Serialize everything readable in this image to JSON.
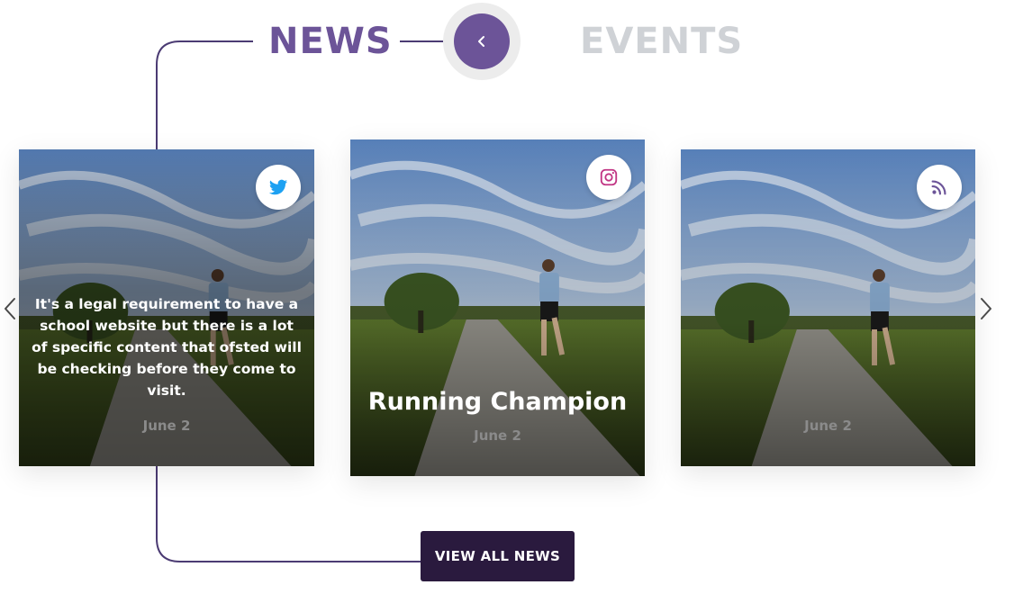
{
  "tabs": {
    "news_label": "NEWS",
    "events_label": "EVENTS",
    "active": "news"
  },
  "colors": {
    "accent": "#6c5498",
    "inactive_tab": "#cfd2d6",
    "button_bg": "#2a1a3e",
    "date_text": "#8b8b8b",
    "twitter": "#1da1f2",
    "instagram": "#c13584",
    "rss": "#6c5498"
  },
  "toggle": {
    "icon": "chevron-left-icon"
  },
  "carousel": {
    "prev_icon": "chevron-left-icon",
    "next_icon": "chevron-right-icon",
    "cards": [
      {
        "social_icon": "twitter-icon",
        "excerpt": "It's a legal requirement to have a school website but there is a lot of specific content that ofsted will be checking before they come to visit.",
        "date": "June 2"
      },
      {
        "social_icon": "instagram-icon",
        "title": "Running Champion",
        "date": "June 2"
      },
      {
        "social_icon": "rss-icon",
        "date": "June 2"
      }
    ]
  },
  "view_all": {
    "label": "VIEW ALL NEWS"
  }
}
